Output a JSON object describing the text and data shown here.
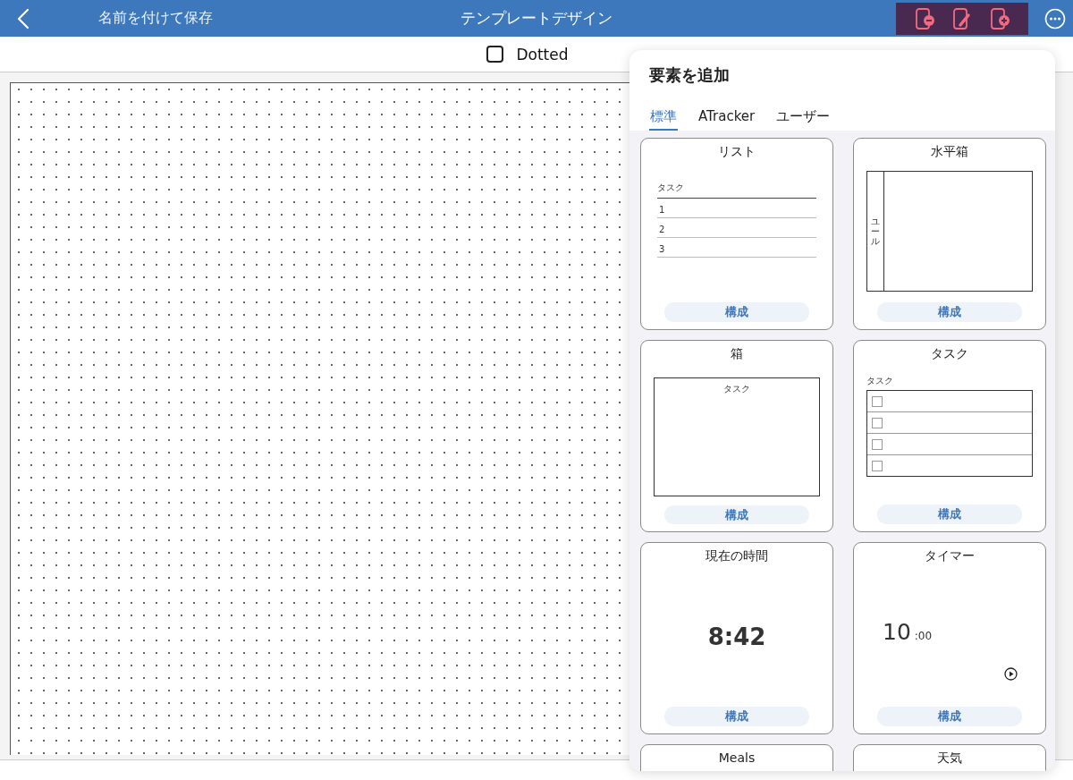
{
  "header": {
    "back_label": "名前を付けて保存",
    "title": "テンプレートデザイン",
    "tools_highlighted": true
  },
  "options": {
    "dotted": {
      "label": "Dotted",
      "checked": false
    }
  },
  "popover": {
    "title": "要素を追加",
    "tabs": [
      {
        "label": "標準",
        "selected": true
      },
      {
        "label": "ATracker",
        "selected": false
      },
      {
        "label": "ユーザー",
        "selected": false
      }
    ],
    "cards": [
      {
        "kind": "list",
        "title": "リスト",
        "header": "タスク",
        "rows": [
          "1",
          "2",
          "3"
        ],
        "button": "構成"
      },
      {
        "kind": "hbox",
        "title": "水平箱",
        "side_label": "ユール",
        "button": "構成"
      },
      {
        "kind": "box",
        "title": "箱",
        "inner_label": "タスク",
        "button": "構成"
      },
      {
        "kind": "task",
        "title": "タスク",
        "header": "タスク",
        "items": [
          {
            "checked": false
          },
          {
            "checked": false
          },
          {
            "checked": false
          },
          {
            "checked": false
          }
        ],
        "button": "構成"
      },
      {
        "kind": "clock",
        "title": "現在の時間",
        "time": "8:42",
        "button": "構成"
      },
      {
        "kind": "timer",
        "title": "タイマー",
        "minutes": "10",
        "seconds": ":00",
        "button": "構成"
      },
      {
        "kind": "partial",
        "title": "Meals"
      },
      {
        "kind": "partial",
        "title": "天気"
      }
    ]
  }
}
